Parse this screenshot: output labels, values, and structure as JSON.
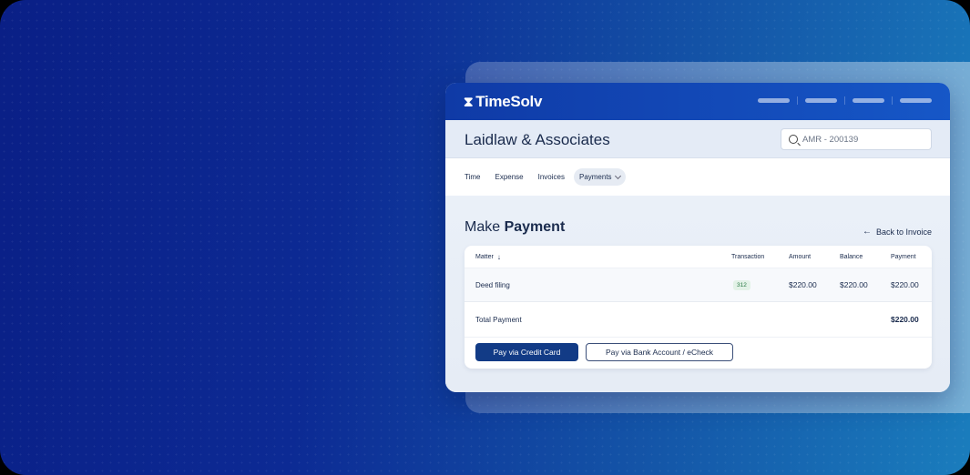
{
  "app": {
    "brand": "TimeSolv",
    "brand_icon": "hourglass-icon",
    "accent": "#123b86"
  },
  "header": {
    "firm_name": "Laidlaw & Associates",
    "search_value": "AMR - 200139"
  },
  "tabs": [
    {
      "label": "Time"
    },
    {
      "label": "Expense"
    },
    {
      "label": "Invoices"
    },
    {
      "label": "Payments",
      "active": true
    }
  ],
  "page": {
    "title_light": "Make",
    "title_bold": "Payment",
    "back_link": "Back to Invoice"
  },
  "table": {
    "headers": {
      "matter": "Matter",
      "transaction": "Transaction",
      "amount": "Amount",
      "balance": "Balance",
      "payment": "Payment"
    },
    "rows": [
      {
        "matter": "Deed filing",
        "transaction": "312",
        "amount": "$220.00",
        "balance": "$220.00",
        "payment": "$220.00"
      }
    ],
    "total_label": "Total Payment",
    "total_value": "$220.00"
  },
  "actions": {
    "credit_card": "Pay via Credit Card",
    "bank": "Pay via Bank Account / eCheck"
  }
}
